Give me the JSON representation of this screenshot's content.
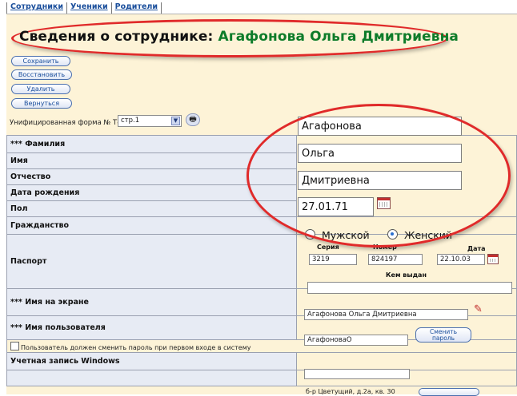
{
  "tabs": [
    "Сотрудники",
    "Ученики",
    "Родители"
  ],
  "header": {
    "title_prefix": "Сведения о сотруднике: ",
    "employee_name": "Агафонова Ольга Дмитриевна"
  },
  "buttons": {
    "save": "Сохранить",
    "restore": "Восстановить",
    "delete": "Удалить",
    "back": "Вернуться",
    "change_password": "Сменить пароль"
  },
  "form_selector": {
    "label": "Унифицированная форма № Т-2",
    "page": "стр.1"
  },
  "fields": {
    "surname_label": "*** Фамилия",
    "name_label": "Имя",
    "patronymic_label": "Отчество",
    "birthdate_label": "Дата рождения",
    "gender_label": "Пол",
    "citizenship_label": "Гражданство",
    "passport_label": "Паспорт",
    "display_name_label": "*** Имя на экране",
    "username_label": "*** Имя пользователя",
    "must_change_password": "Пользователь должен сменить пароль при первом входе в систему",
    "windows_account_label": "Учетная запись Windows"
  },
  "values": {
    "surname": "Агафонова",
    "name": "Ольга",
    "patronymic": "Дмитриевна",
    "birthdate": "27.01.71",
    "gender_options": [
      "Мужской",
      "Женский"
    ],
    "gender_selected": "Женский",
    "passport_series_label": "Серия",
    "passport_number_label": "Номер",
    "passport_date_label": "Дата",
    "passport_series": "3219",
    "passport_number": "824197",
    "passport_date": "22.10.03",
    "passport_issued_label": "Кем выдан",
    "passport_issued": "",
    "display_name": "Агафонова Ольга Дмитриевна",
    "username": "АгафоноваО",
    "windows_account": "",
    "address_partial": "б-р Цветущий, д.2а, кв. 30"
  },
  "colors": {
    "panel_bg": "#fdf3d7",
    "label_bg": "#e7ebf4",
    "highlight_red": "#e02a2a",
    "employee_name": "#0e7c2a",
    "link_blue": "#1b4f9c"
  }
}
